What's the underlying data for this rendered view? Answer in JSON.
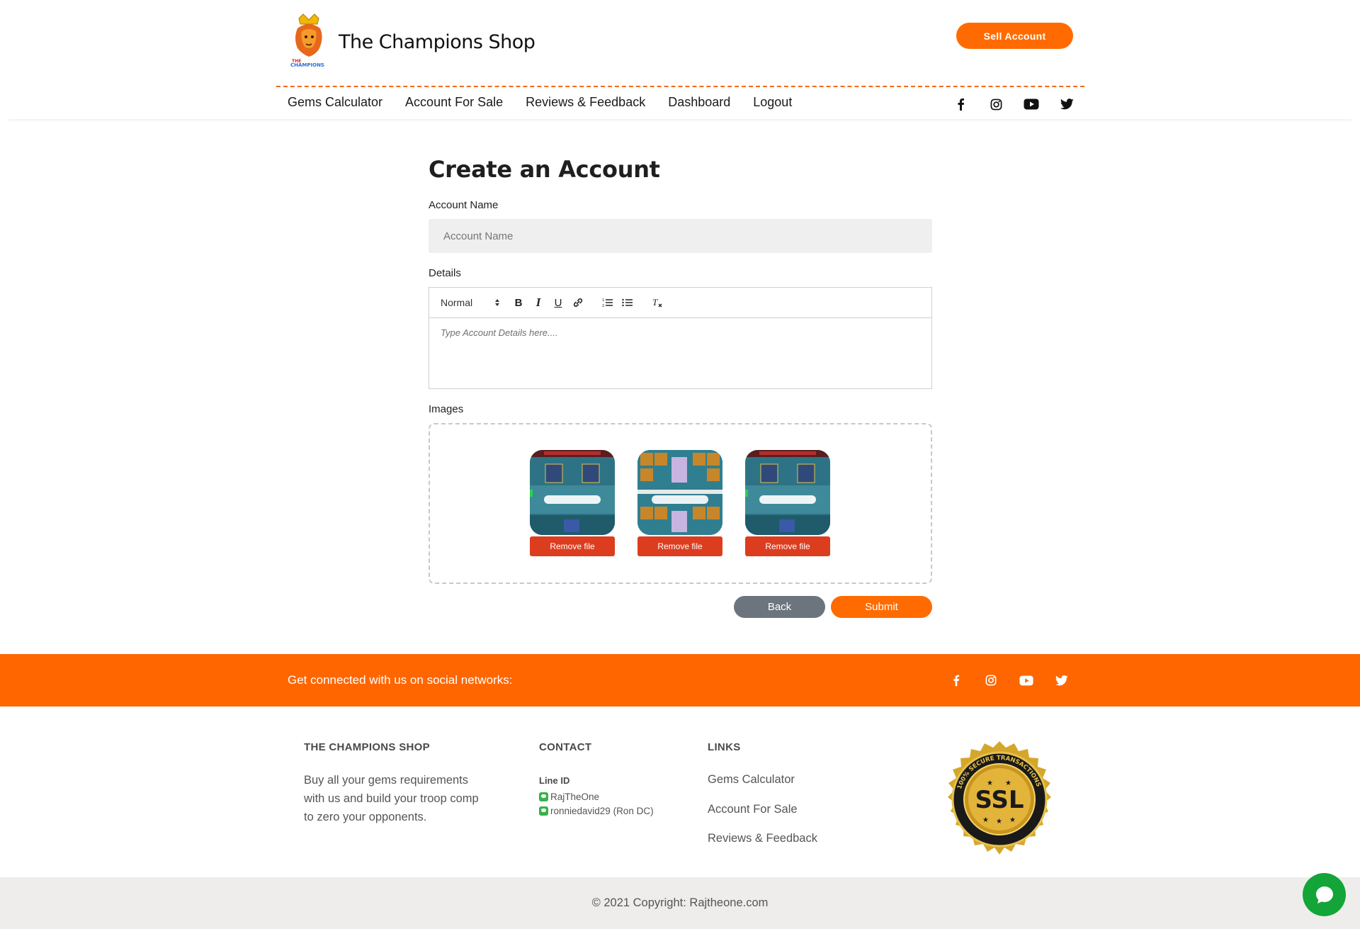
{
  "header": {
    "brand_name": "The Champions Shop",
    "sell_button": "Sell Account",
    "nav": [
      "Gems Calculator",
      "Account For Sale",
      "Reviews & Feedback",
      "Dashboard",
      "Logout"
    ],
    "social_icons": [
      "facebook-icon",
      "instagram-icon",
      "youtube-icon",
      "twitter-icon"
    ]
  },
  "form": {
    "title": "Create an Account",
    "account_name_label": "Account Name",
    "account_name_placeholder": "Account Name",
    "account_name_value": "",
    "details_label": "Details",
    "editor": {
      "format_select": "Normal",
      "placeholder": "Type Account Details here....",
      "tools": [
        "bold-icon",
        "italic-icon",
        "underline-icon",
        "link-icon",
        "ordered-list-icon",
        "bullet-list-icon",
        "clear-format-icon"
      ]
    },
    "images_label": "Images",
    "images": [
      {
        "remove_label": "Remove file"
      },
      {
        "remove_label": "Remove file"
      },
      {
        "remove_label": "Remove file"
      }
    ],
    "back_button": "Back",
    "submit_button": "Submit"
  },
  "social_band": {
    "text": "Get connected with us on social networks:"
  },
  "footer": {
    "about_heading": "THE CHAMPIONS SHOP",
    "about_text": "Buy all your gems requirements with us and build your troop comp to zero your opponents.",
    "contact_heading": "CONTACT",
    "line_id_label": "Line ID",
    "contacts": [
      "RajTheOne",
      "ronniedavid29 (Ron DC)"
    ],
    "links_heading": "LINKS",
    "links": [
      "Gems Calculator",
      "Account For Sale",
      "Reviews & Feedback"
    ],
    "copyright": "© 2021 Copyright: Rajtheone.com"
  },
  "colors": {
    "accent": "#ff6b00",
    "band": "#ff6600",
    "remove": "#dd3d1f",
    "back": "#6c757d",
    "chat": "#13a538"
  }
}
